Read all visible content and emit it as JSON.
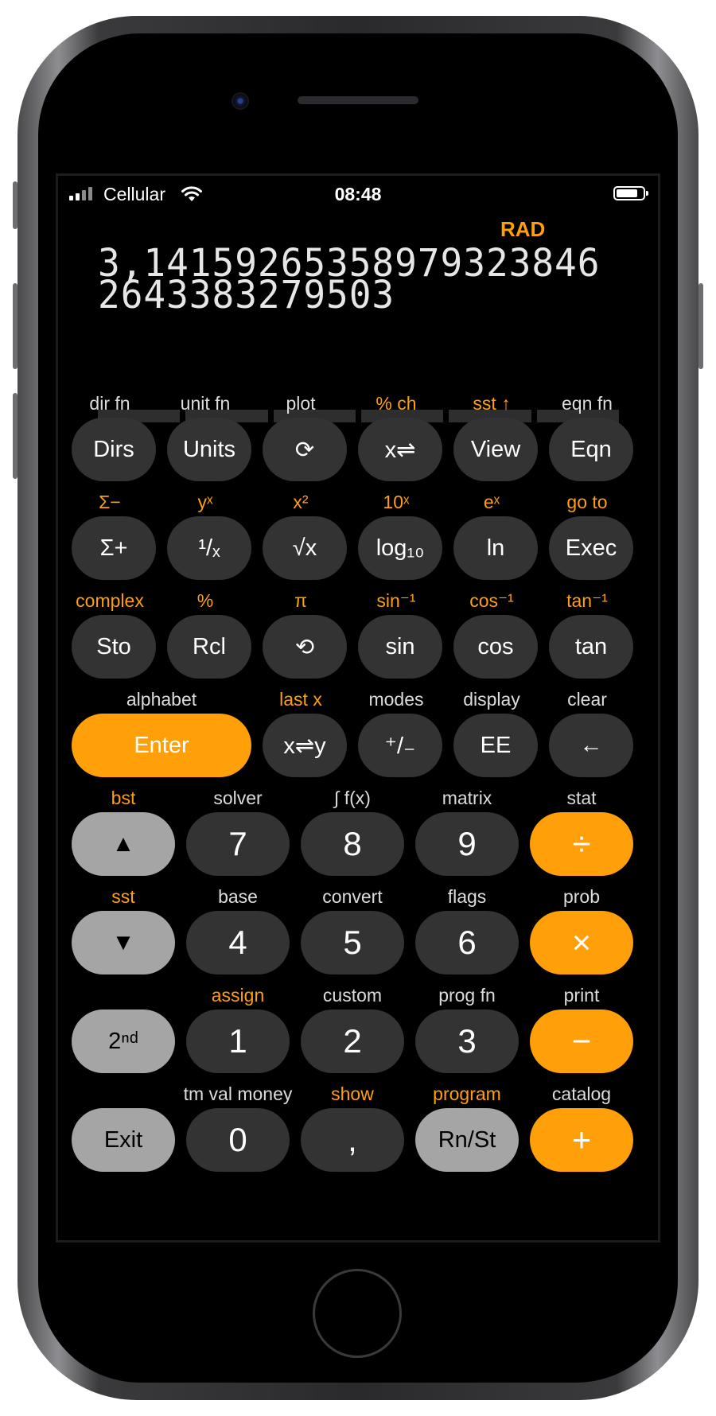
{
  "status": {
    "carrier": "Cellular",
    "time": "08:48"
  },
  "display": {
    "mode": "RAD",
    "line1": "3,141592653589793238 46",
    "line1_text": "3,14159265358979323846",
    "line2": "264338327950 3",
    "line2_text": "2643383279503"
  },
  "rows": [
    {
      "labels": [
        "dir fn",
        "unit fn",
        "plot",
        "% ch",
        "sst ↑",
        "eqn fn"
      ],
      "keys": [
        "Dirs",
        "Units",
        "⟳",
        "x⇌",
        "View",
        "Eqn"
      ]
    },
    {
      "labels": [
        "Σ−",
        "yˣ",
        "x²",
        "10ˣ",
        "eˣ",
        "go to"
      ],
      "keys": [
        "Σ+",
        "¹/ₓ",
        "√x",
        "log₁₀",
        "ln",
        "Exec"
      ]
    },
    {
      "labels": [
        "complex",
        "%",
        "π",
        "sin⁻¹",
        "cos⁻¹",
        "tan⁻¹"
      ],
      "keys": [
        "Sto",
        "Rcl",
        "⟲",
        "sin",
        "cos",
        "tan"
      ]
    },
    {
      "labels": [
        "alphabet",
        "last x",
        "modes",
        "display",
        "clear"
      ],
      "keys": [
        "Enter",
        "x⇌y",
        "⁺/₋",
        "EE",
        "←"
      ]
    },
    {
      "labels": [
        "bst",
        "solver",
        "∫ f(x)",
        "matrix",
        "stat"
      ],
      "keys": [
        "▲",
        "7",
        "8",
        "9",
        "÷"
      ]
    },
    {
      "labels": [
        "sst",
        "base",
        "convert",
        "flags",
        "prob"
      ],
      "keys": [
        "▼",
        "4",
        "5",
        "6",
        "×"
      ]
    },
    {
      "labels": [
        "",
        "assign",
        "custom",
        "prog fn",
        "print"
      ],
      "keys": [
        "2ⁿᵈ",
        "1",
        "2",
        "3",
        "−"
      ]
    },
    {
      "labels": [
        "",
        "tm val money",
        "show",
        "program",
        "catalog"
      ],
      "keys": [
        "Exit",
        "0",
        ",",
        "Rn/St",
        "+"
      ]
    }
  ],
  "colors": {
    "orange": "#ff9f0a",
    "dark_key": "#333333",
    "light_key": "#a5a5a5"
  }
}
